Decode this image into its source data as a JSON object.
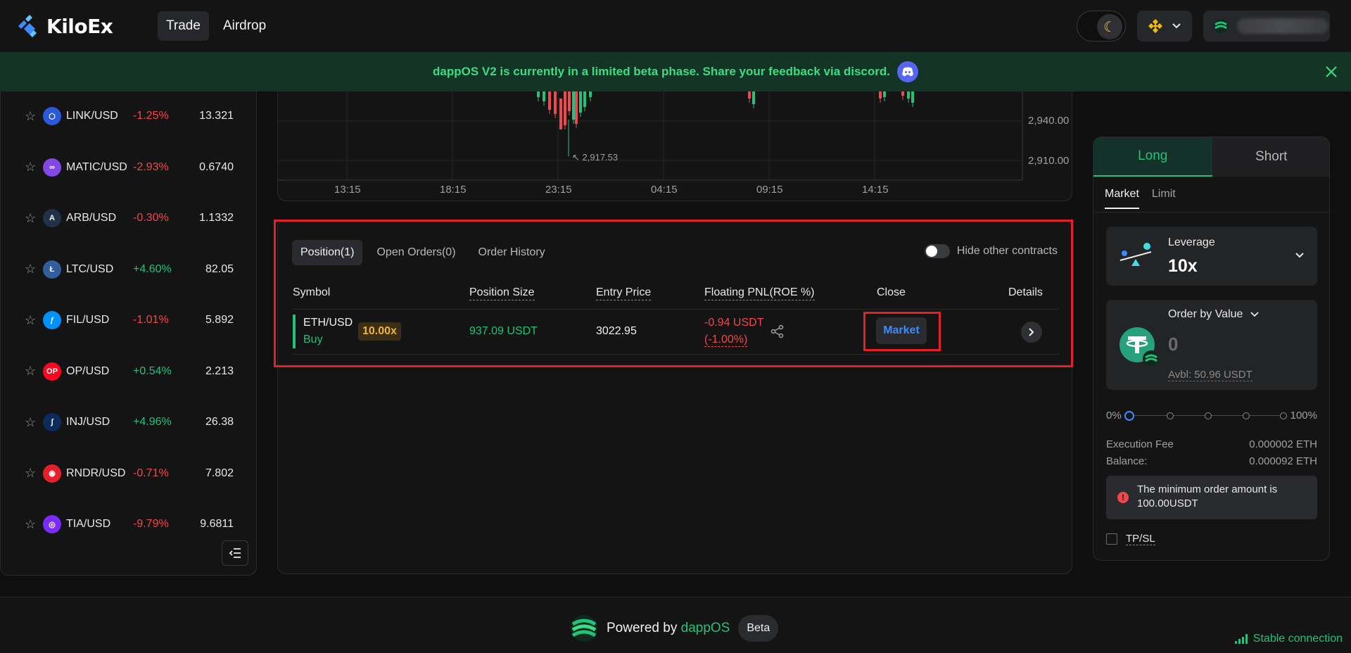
{
  "header": {
    "brand": "KiloEx",
    "nav": [
      "Trade",
      "Airdrop"
    ]
  },
  "banner": {
    "text": "dappOS V2 is currently in a limited beta phase. Share your feedback via discord."
  },
  "markets": [
    {
      "symbol": "LINK/USD",
      "change": "-1.25%",
      "price": "13.321",
      "dir": "down",
      "icon_color": "#ffffff",
      "icon_bg": "#2a5ada"
    },
    {
      "symbol": "MATIC/USD",
      "change": "-2.93%",
      "price": "0.6740",
      "dir": "down",
      "icon_color": "#ffffff",
      "icon_bg": "#8247e5"
    },
    {
      "symbol": "ARB/USD",
      "change": "-0.30%",
      "price": "1.1332",
      "dir": "down",
      "icon_color": "#ffffff",
      "icon_bg": "#213147"
    },
    {
      "symbol": "LTC/USD",
      "change": "+4.60%",
      "price": "82.05",
      "dir": "up",
      "icon_color": "#ffffff",
      "icon_bg": "#345d9d"
    },
    {
      "symbol": "FIL/USD",
      "change": "-1.01%",
      "price": "5.892",
      "dir": "down",
      "icon_color": "#ffffff",
      "icon_bg": "#0090ff"
    },
    {
      "symbol": "OP/USD",
      "change": "+0.54%",
      "price": "2.213",
      "dir": "up",
      "icon_color": "#ffffff",
      "icon_bg": "#ff0420"
    },
    {
      "symbol": "INJ/USD",
      "change": "+4.96%",
      "price": "26.38",
      "dir": "up",
      "icon_color": "#ffffff",
      "icon_bg": "#0b2b5a"
    },
    {
      "symbol": "RNDR/USD",
      "change": "-0.71%",
      "price": "7.802",
      "dir": "down",
      "icon_color": "#ffffff",
      "icon_bg": "#e5202a"
    },
    {
      "symbol": "TIA/USD",
      "change": "-9.79%",
      "price": "9.6811",
      "dir": "down",
      "icon_color": "#ffffff",
      "icon_bg": "#7b2bf9"
    }
  ],
  "chart": {
    "x_labels": [
      "13:15",
      "18:15",
      "23:15",
      "04:15",
      "09:15",
      "14:15"
    ],
    "y_labels": [
      "2,940.00",
      "2,910.00"
    ],
    "low_marker": "2,917.53"
  },
  "positions": {
    "tabs": [
      "Position(1)",
      "Open Orders(0)",
      "Order History"
    ],
    "hide_other": "Hide other contracts",
    "columns": [
      "Symbol",
      "Position Size",
      "Entry Price",
      "Floating PNL(ROE %)",
      "Close",
      "Details"
    ],
    "rows": [
      {
        "symbol": "ETH/USD",
        "side": "Buy",
        "leverage": "10.00x",
        "size": "937.09 USDT",
        "entry": "3022.95",
        "pnl": "-0.94 USDT",
        "roe": "(-1.00%)",
        "close_label": "Market"
      }
    ]
  },
  "order": {
    "long": "Long",
    "short": "Short",
    "types": [
      "Market",
      "Limit"
    ],
    "leverage_title": "Leverage",
    "leverage_value": "10x",
    "order_by": "Order by Value",
    "input_value": "0",
    "avbl": "Avbl: 50.96 USDT",
    "slider_min": "0%",
    "slider_max": "100%",
    "slider_fraction": 0,
    "exec_fee_label": "Execution Fee",
    "exec_fee_value": "0.000002 ETH",
    "balance_label": "Balance:",
    "balance_value": "0.000092 ETH",
    "warning": "The minimum order amount is 100.00USDT",
    "tpsl": "TP/SL"
  },
  "footer": {
    "powered": "Powered by",
    "dappos": "dappOS",
    "beta": "Beta",
    "status": "Stable connection"
  },
  "colors": {
    "green": "#21c27a",
    "red": "#f0484e",
    "accent_blue": "#3d8bff",
    "highlight": "#e5202a"
  }
}
